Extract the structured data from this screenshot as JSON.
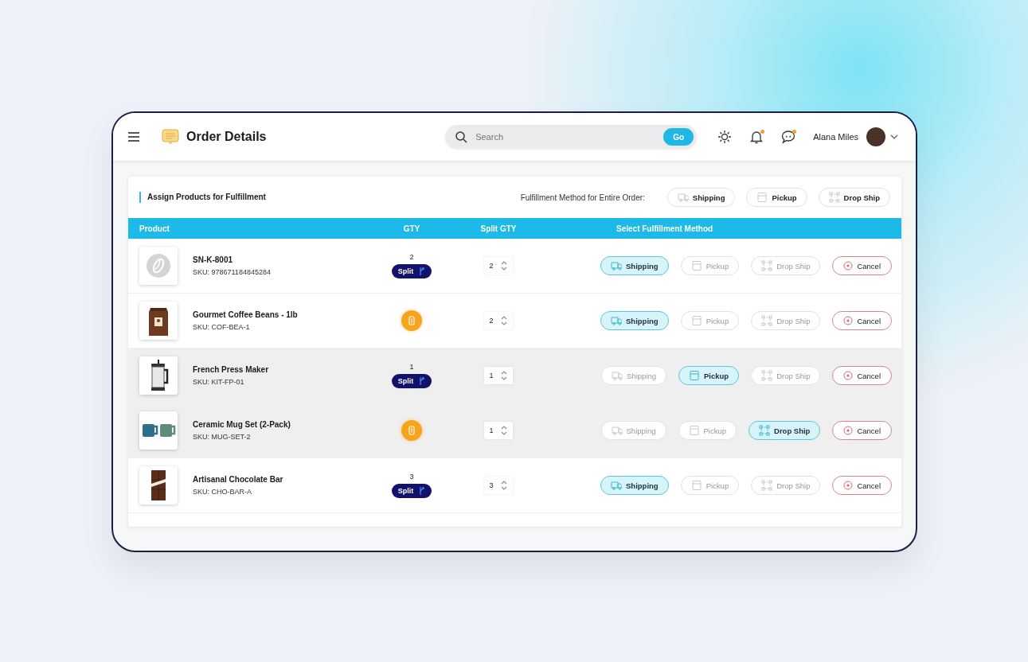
{
  "header": {
    "title": "Order Details",
    "search": {
      "placeholder": "Search",
      "button": "Go"
    },
    "notifications_unread": true,
    "messages_unread": true,
    "user": {
      "name": "Alana Miles"
    }
  },
  "panel": {
    "title": "Assign Products for Fulfillment",
    "bulk_label": "Fulfillment Method for Entire Order:",
    "bulk_methods": [
      {
        "kind": "shipping",
        "label": "Shipping"
      },
      {
        "kind": "pickup",
        "label": "Pickup"
      },
      {
        "kind": "dropship",
        "label": "Drop Ship"
      }
    ]
  },
  "table": {
    "columns": [
      "Product",
      "GTY",
      "Split GTY",
      "Select Fulfillment Method"
    ],
    "rows": [
      {
        "name": "SN-K-8001",
        "sku": "SKU: 978671184845284",
        "highlighted": false,
        "split_available": true,
        "qty": "2",
        "split_label": "Split",
        "split_qty": "2",
        "methods": [
          {
            "kind": "shipping",
            "label": "Shipping",
            "selected": true
          },
          {
            "kind": "pickup",
            "label": "Pickup",
            "selected": false
          },
          {
            "kind": "dropship",
            "label": "Drop Ship",
            "selected": false
          }
        ],
        "cancel": "Cancel"
      },
      {
        "name": "Gourmet Coffee Beans - 1lb",
        "sku": "SKU: COF-BEA-1",
        "highlighted": false,
        "split_available": false,
        "split_qty": "2",
        "methods": [
          {
            "kind": "shipping",
            "label": "Shipping",
            "selected": true
          },
          {
            "kind": "pickup",
            "label": "Pickup",
            "selected": false
          },
          {
            "kind": "dropship",
            "label": "Drop Ship",
            "selected": false
          }
        ],
        "cancel": "Cancel"
      },
      {
        "name": "French Press Maker",
        "sku": "SKU: KIT-FP-01",
        "highlighted": true,
        "split_available": true,
        "qty": "1",
        "split_label": "Split",
        "split_qty": "1",
        "methods": [
          {
            "kind": "shipping",
            "label": "Shipping",
            "selected": false
          },
          {
            "kind": "pickup",
            "label": "Pickup",
            "selected": true
          },
          {
            "kind": "dropship",
            "label": "Drop Ship",
            "selected": false
          }
        ],
        "cancel": "Cancel"
      },
      {
        "name": "Ceramic Mug Set (2-Pack)",
        "sku": "SKU: MUG-SET-2",
        "highlighted": true,
        "split_available": false,
        "split_qty": "1",
        "methods": [
          {
            "kind": "shipping",
            "label": "Shipping",
            "selected": false
          },
          {
            "kind": "pickup",
            "label": "Pickup",
            "selected": false
          },
          {
            "kind": "dropship",
            "label": "Drop Ship",
            "selected": true
          }
        ],
        "cancel": "Cancel"
      },
      {
        "name": "Artisanal Chocolate Bar",
        "sku": "SKU: CHO-BAR-A",
        "highlighted": false,
        "split_available": true,
        "qty": "3",
        "split_label": "Split",
        "split_qty": "3",
        "methods": [
          {
            "kind": "shipping",
            "label": "Shipping",
            "selected": true
          },
          {
            "kind": "pickup",
            "label": "Pickup",
            "selected": false
          },
          {
            "kind": "dropship",
            "label": "Drop Ship",
            "selected": false
          }
        ],
        "cancel": "Cancel"
      }
    ]
  }
}
